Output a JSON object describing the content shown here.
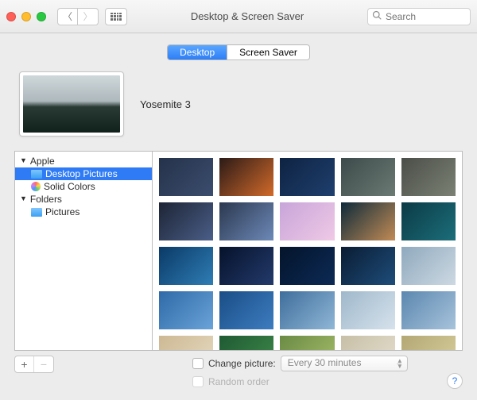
{
  "window": {
    "title": "Desktop & Screen Saver"
  },
  "search": {
    "placeholder": "Search"
  },
  "tabs": {
    "desktop": "Desktop",
    "screensaver": "Screen Saver",
    "active": "desktop"
  },
  "current_picture": {
    "name": "Yosemite 3"
  },
  "sidebar": {
    "groups": [
      {
        "label": "Apple",
        "expanded": true,
        "items": [
          {
            "label": "Desktop Pictures",
            "icon": "folder",
            "selected": true
          },
          {
            "label": "Solid Colors",
            "icon": "rainbow",
            "selected": false
          }
        ]
      },
      {
        "label": "Folders",
        "expanded": true,
        "items": [
          {
            "label": "Pictures",
            "icon": "folder",
            "selected": false
          }
        ]
      }
    ]
  },
  "thumbnails": [
    [
      "#25324a/#3b4d6e",
      "#2b1a17/#d26a2a",
      "#0e2342/#1f3f6e",
      "#3c4a4a/#6c7a74",
      "#4a4e48/#7c8174"
    ],
    [
      "#1d2435/#4a5e88",
      "#2b384f/#6d89b8",
      "#c7a5d9/#f0c9e6",
      "#0d2a3a/#c28b55",
      "#0b3a45/#1b6e7a"
    ],
    [
      "#0a3a66/#2f7db5",
      "#06122b/#233a6b",
      "#04142b/#0c2a55",
      "#0a1c33/#1e4d7a",
      "#8fa9bd/#cdd9e3"
    ],
    [
      "#2f6aa8/#6aa3d8",
      "#1a4e86/#3d7cc0",
      "#3f6e9c/#8fb6d6",
      "#9fb8cb/#d6e2ec",
      "#5b87af/#a7c3db"
    ],
    [
      "#cdb893/#e6dcc3",
      "#1f5a33/#3f8a4a",
      "#6a8a45/#a8c06a",
      "#c7bfa7/#e6e0cf",
      "#b3a874/#d9d0a0"
    ]
  ],
  "options": {
    "change_label": "Change picture:",
    "interval": "Every 30 minutes",
    "random_label": "Random order",
    "change_checked": false,
    "random_checked": false
  },
  "help": {
    "label": "?"
  }
}
